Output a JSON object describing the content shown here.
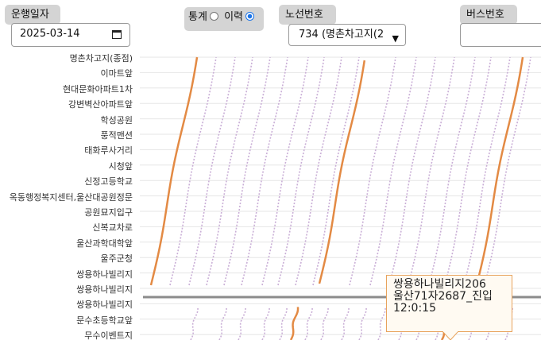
{
  "filters": {
    "date_label": "운행일자",
    "date_value": "2025-03-14",
    "mode_label": "통계",
    "mode_option_history": "이력",
    "route_label": "노선번호",
    "route_value": "734 (명촌차고지(2",
    "bus_label": "버스번호",
    "bus_value": ""
  },
  "stops": [
    "명촌차고지(종점)",
    "이마트앞",
    "현대문화아파트1차",
    "강변벽산아파트앞",
    "학성공원",
    "풍적맨션",
    "태화루사거리",
    "시청앞",
    "신정고등학교",
    "옥동행정복지센터,울산대공원정문",
    "공원묘지입구",
    "신복교차로",
    "울산과학대학앞",
    "울주군청",
    "쌍용하나빌리지",
    "쌍용하나빌리지",
    "쌍용하나빌리지",
    "문수초등학교앞",
    "무수이벤트지"
  ],
  "tooltip": {
    "line1": "쌍용하나빌리지206",
    "line2": "울산71자2687_진입",
    "line3": "12:0:15"
  },
  "colors": {
    "highlight": "#e38a44",
    "trips": "#c9aed6",
    "selected_line": "#8c8c8c"
  }
}
